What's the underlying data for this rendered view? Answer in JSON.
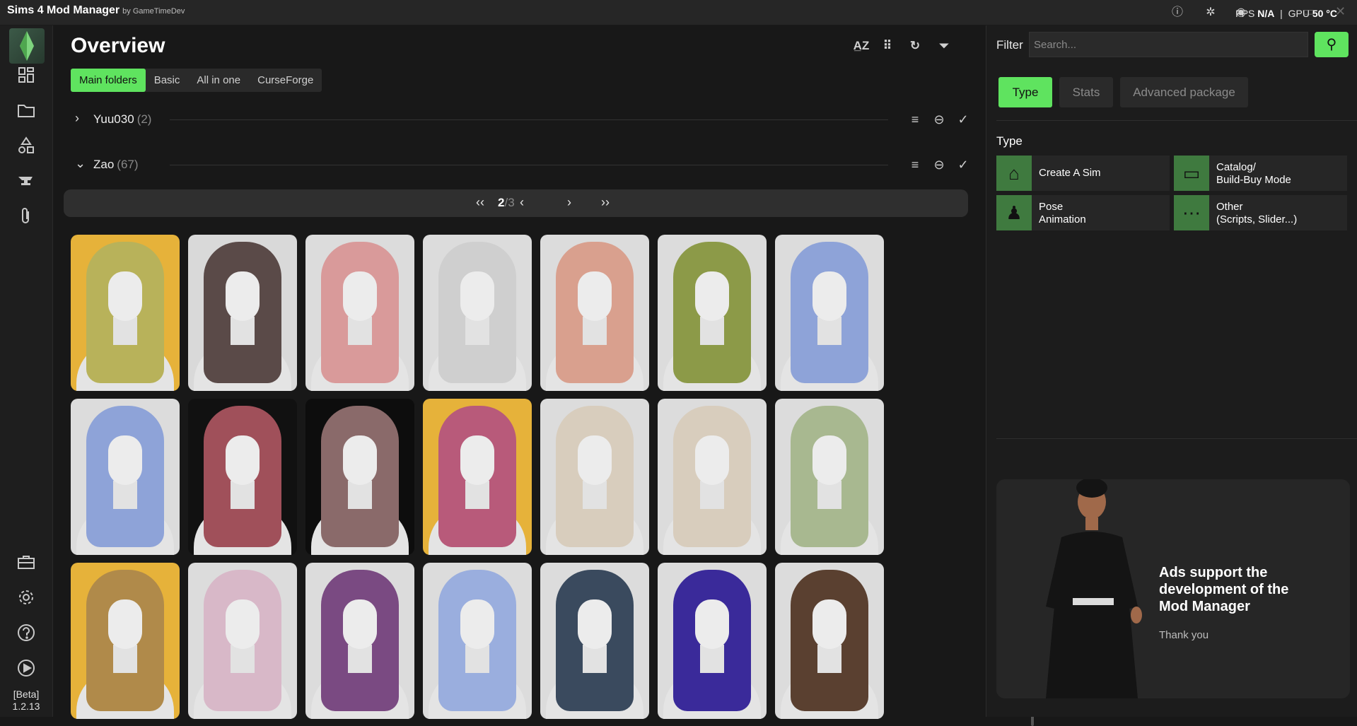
{
  "app": {
    "title": "Sims 4 Mod Manager",
    "by": "by GameTimeDev"
  },
  "status": {
    "fps_label": "FPS",
    "fps_value": "N/A",
    "sep": "|",
    "gpu_label": "GPU",
    "gpu_value": "50 °C"
  },
  "sidebar": {
    "items": [
      "dashboard-icon",
      "folder-icon",
      "shapes-icon",
      "anvil-icon",
      "paperclip-icon"
    ],
    "bottom": [
      "toolbox-icon",
      "gear-icon",
      "help-icon",
      "play-icon"
    ],
    "version": {
      "beta": "[Beta]",
      "number": "1.2.13"
    }
  },
  "main": {
    "title": "Overview",
    "tabs": [
      {
        "label": "Main folders",
        "active": true
      },
      {
        "label": "Basic",
        "active": false
      },
      {
        "label": "All in one",
        "active": false
      },
      {
        "label": "CurseForge",
        "active": false
      }
    ],
    "folders": [
      {
        "name": "Yuu030",
        "count": "(2)",
        "expanded": false
      },
      {
        "name": "Zao",
        "count": "(67)",
        "expanded": true
      }
    ],
    "pager": {
      "current": "2",
      "total": "/3"
    }
  },
  "mods": [
    {
      "hair": "#b8b25a",
      "bg": "#e6b23a"
    },
    {
      "hair": "#5a4a48",
      "bg": "#d9d9d9"
    },
    {
      "hair": "#d99a9a",
      "bg": "#dcdcdc"
    },
    {
      "hair": "#cfcfcf",
      "bg": "#dcdcdc"
    },
    {
      "hair": "#d9a08e",
      "bg": "#dcdcdc"
    },
    {
      "hair": "#8c9a48",
      "bg": "#dcdcdc"
    },
    {
      "hair": "#8ea3d8",
      "bg": "#dcdcdc"
    },
    {
      "hair": "#8ea3d8",
      "bg": "#dcdcdc"
    },
    {
      "hair": "#a0505a",
      "bg": "#111111"
    },
    {
      "hair": "#8a6a6a",
      "bg": "#0d0d0d"
    },
    {
      "hair": "#b85a7a",
      "bg": "#e6b23a"
    },
    {
      "hair": "#d8cdbd",
      "bg": "#dcdcdc"
    },
    {
      "hair": "#d8cdbd",
      "bg": "#dcdcdc"
    },
    {
      "hair": "#a8b890",
      "bg": "#dcdcdc"
    },
    {
      "hair": "#b08a4a",
      "bg": "#e6b23a"
    },
    {
      "hair": "#d8b8c8",
      "bg": "#dcdcdc"
    },
    {
      "hair": "#7a4a82",
      "bg": "#dcdcdc"
    },
    {
      "hair": "#9aaede",
      "bg": "#dcdcdc"
    },
    {
      "hair": "#3a4a5e",
      "bg": "#dcdcdc"
    },
    {
      "hair": "#3a2a9a",
      "bg": "#dcdcdc"
    },
    {
      "hair": "#5a4030",
      "bg": "#dcdcdc"
    }
  ],
  "filter": {
    "label": "Filter",
    "search_placeholder": "Search...",
    "tabs": [
      {
        "label": "Type",
        "active": true
      },
      {
        "label": "Stats",
        "active": false
      },
      {
        "label": "Advanced package",
        "active": false
      }
    ],
    "type_heading": "Type",
    "types": [
      {
        "label": "Create A Sim",
        "icon": "hanger-icon"
      },
      {
        "label": "Catalog/\nBuild-Buy Mode",
        "icon": "sofa-icon"
      },
      {
        "label": "Pose\nAnimation",
        "icon": "pose-icon"
      },
      {
        "label": "Other\n(Scripts, Slider...)",
        "icon": "dots-icon"
      }
    ]
  },
  "ad": {
    "headline": "Ads support the development of the Mod Manager",
    "thanks": "Thank you"
  },
  "colors": {
    "accent": "#5fe35f",
    "bg": "#181818",
    "panel": "#1c1c1c"
  }
}
